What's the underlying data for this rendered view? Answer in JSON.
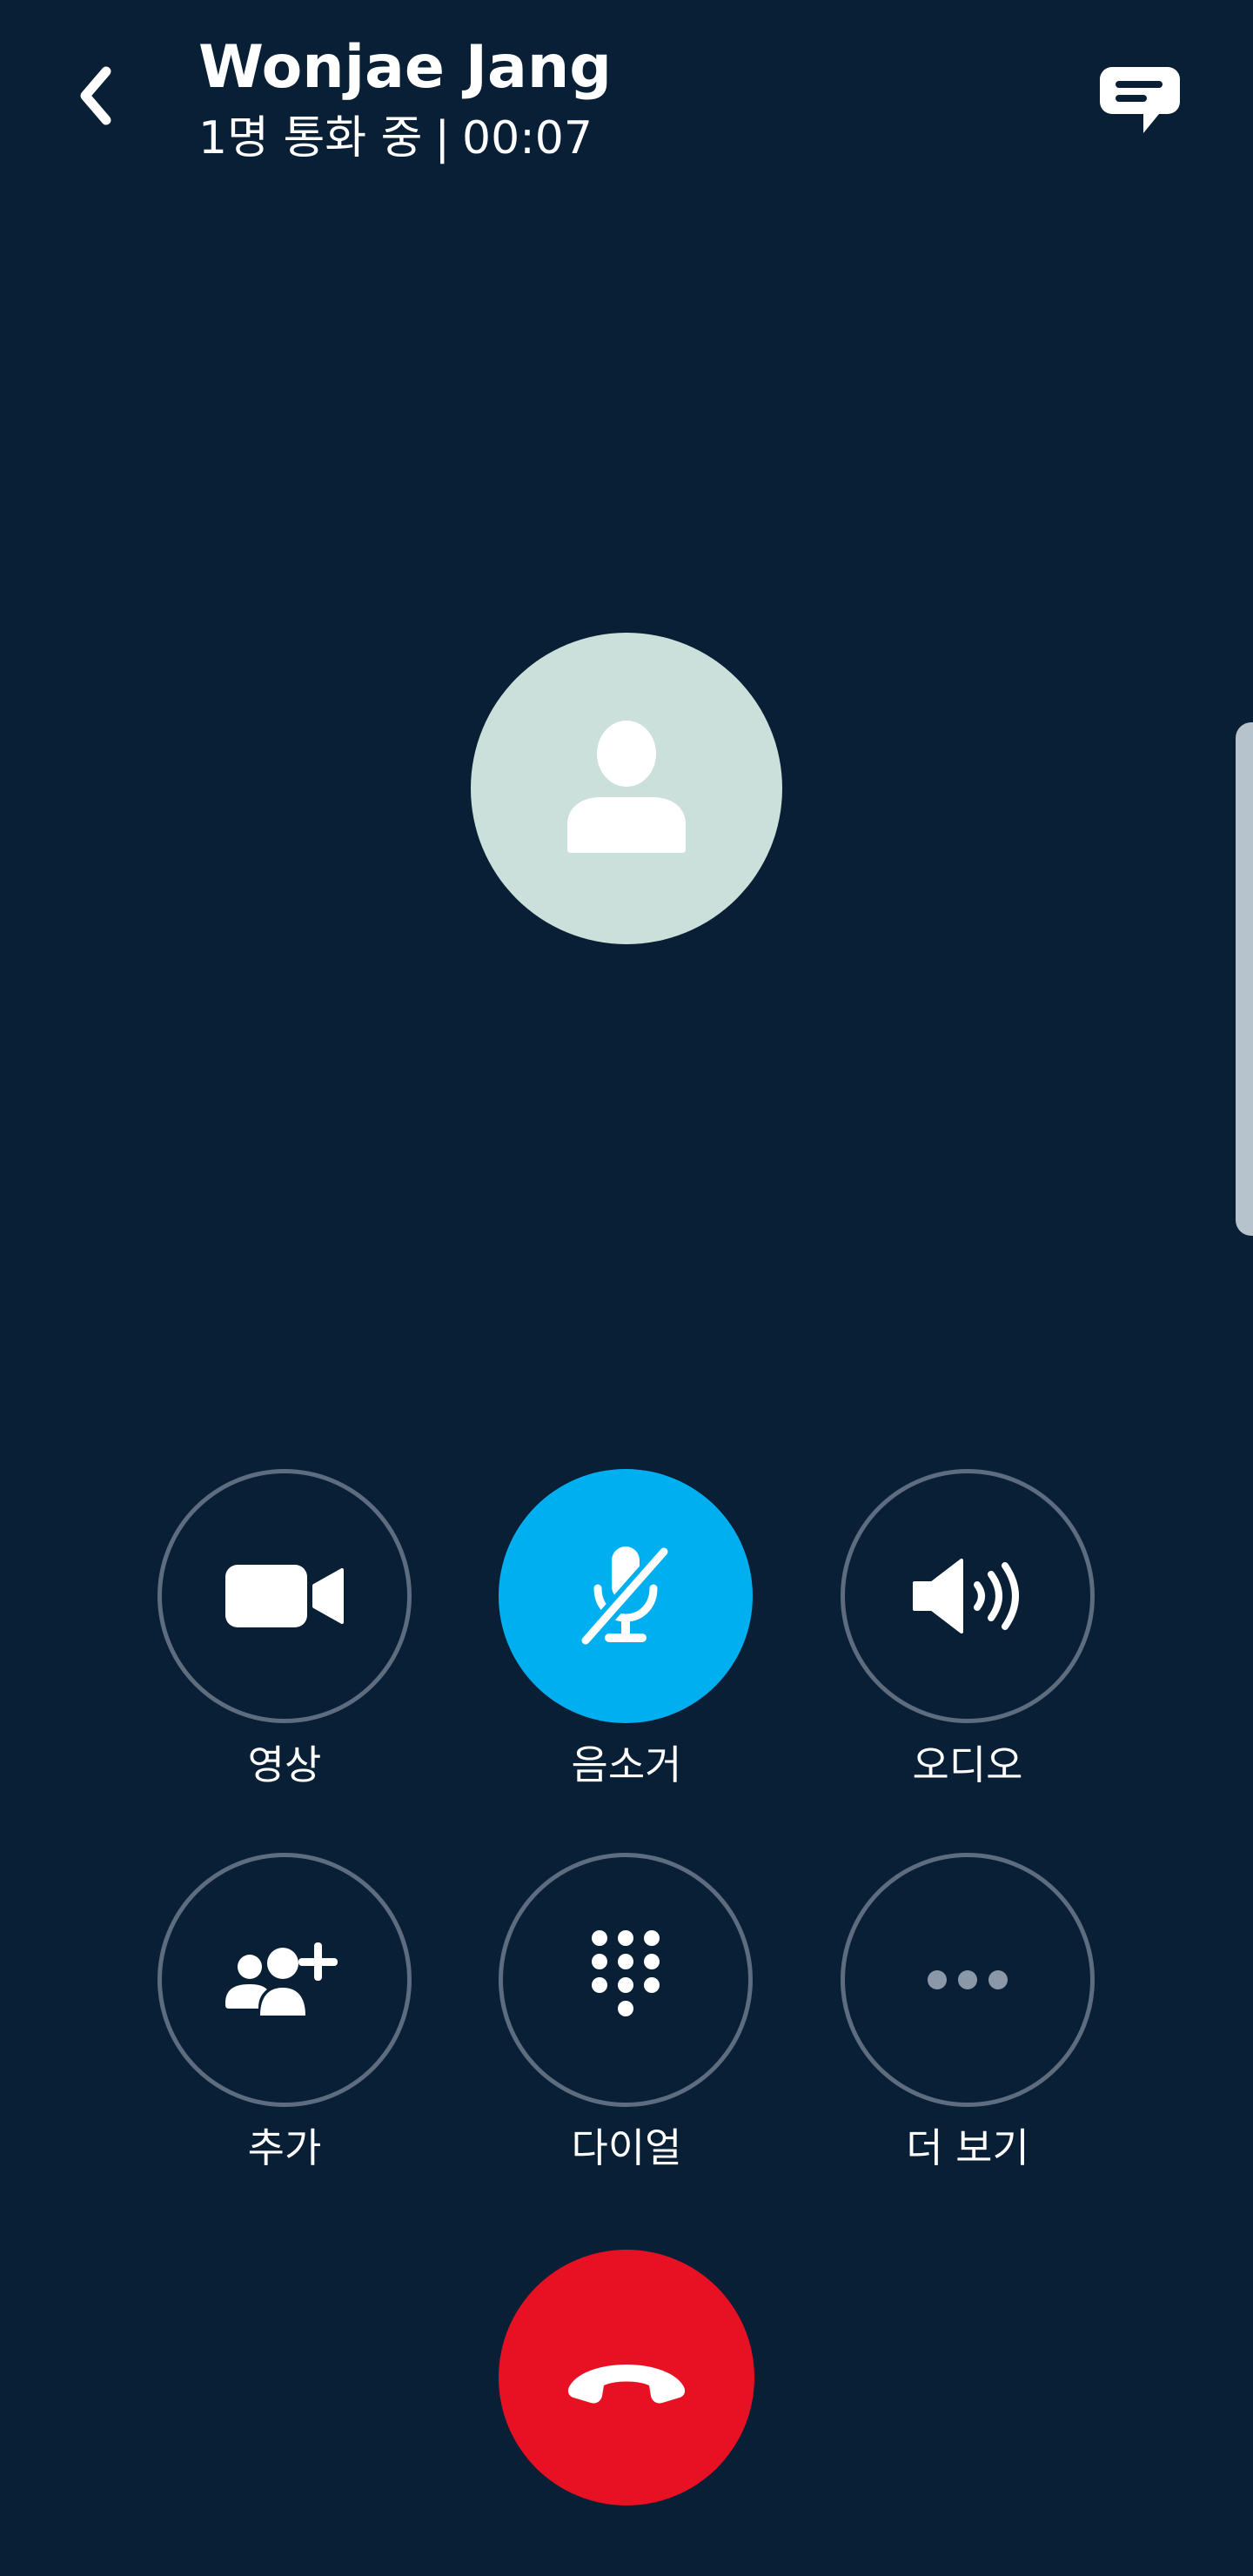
{
  "header": {
    "title": "Wonjae Jang",
    "participants": "1명 통화 중",
    "separator": "|",
    "duration": "00:07"
  },
  "controls": [
    {
      "label": "영상",
      "icon": "video-camera-icon",
      "active": false
    },
    {
      "label": "음소거",
      "icon": "microphone-muted-icon",
      "active": true
    },
    {
      "label": "오디오",
      "icon": "speaker-icon",
      "active": false
    },
    {
      "label": "추가",
      "icon": "add-people-icon",
      "active": false
    },
    {
      "label": "다이얼",
      "icon": "dialpad-icon",
      "active": false
    },
    {
      "label": "더 보기",
      "icon": "more-dots-icon",
      "active": false
    }
  ],
  "end_call": {
    "icon": "end-call-phone-icon"
  },
  "colors": {
    "background": "#081f36",
    "accent": "#00aff0",
    "end_call": "#e81123",
    "avatar_bg": "#cce0db",
    "button_border": "#5d6d7f"
  }
}
